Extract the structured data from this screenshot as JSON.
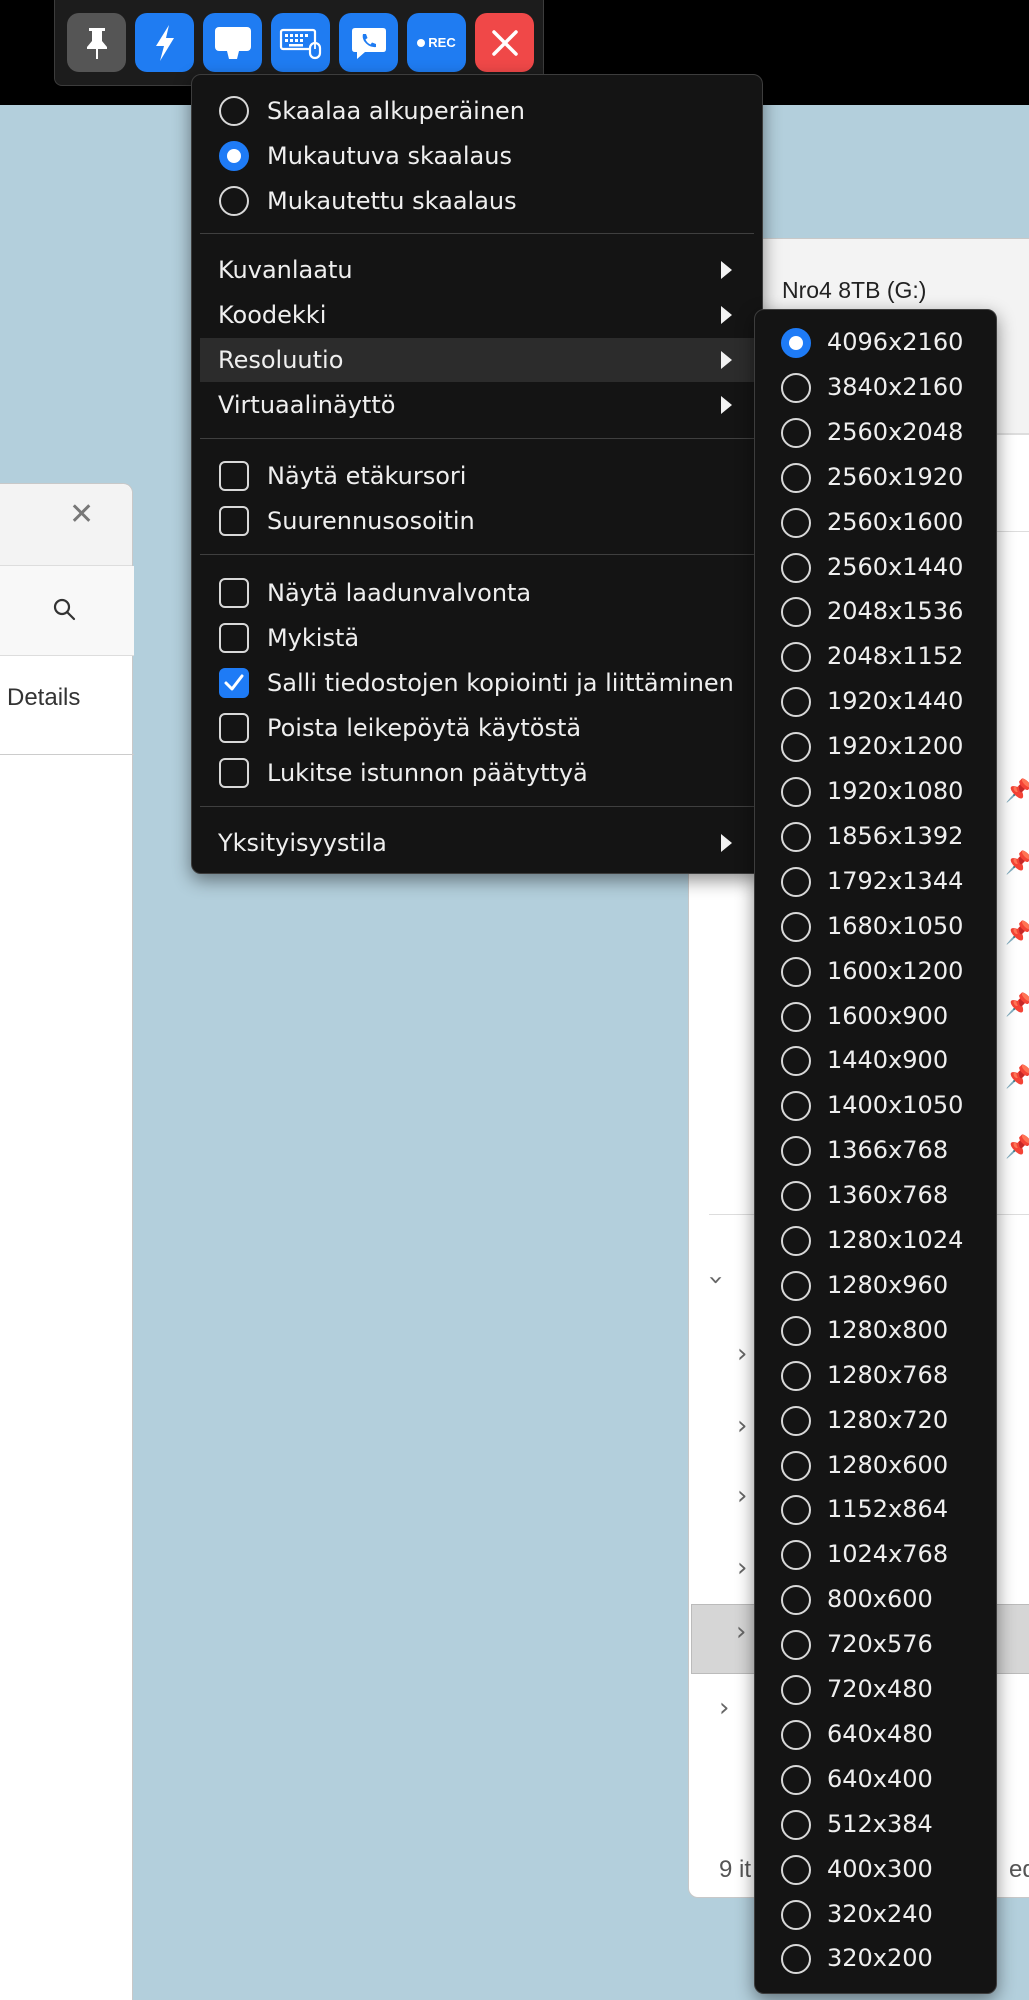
{
  "toolbar": {
    "buttons": [
      {
        "name": "pin-button",
        "icon": "pin-icon"
      },
      {
        "name": "action-button",
        "icon": "lightning-icon"
      },
      {
        "name": "display-button",
        "icon": "monitor-icon"
      },
      {
        "name": "keyboard-mouse-button",
        "icon": "keyboard-mouse-icon"
      },
      {
        "name": "chat-button",
        "icon": "chat-icon"
      },
      {
        "name": "record-button",
        "icon": "rec-icon",
        "label": "REC"
      },
      {
        "name": "close-button",
        "icon": "close-icon"
      }
    ],
    "colors": {
      "blue": "#1f7cf2",
      "dark": "#555555",
      "red": "#f04848"
    }
  },
  "menu": {
    "scaling": [
      {
        "label": "Skaalaa alkuperäinen",
        "selected": false
      },
      {
        "label": "Mukautuva skaalaus",
        "selected": true
      },
      {
        "label": "Mukautettu skaalaus",
        "selected": false
      }
    ],
    "submenus": [
      {
        "label": "Kuvanlaatu"
      },
      {
        "label": "Koodekki"
      },
      {
        "label": "Resoluutio",
        "highlighted": true
      },
      {
        "label": "Virtuaalinäyttö"
      }
    ],
    "options_a": [
      {
        "label": "Näytä etäkursori",
        "checked": false
      },
      {
        "label": "Suurennusosoitin",
        "checked": false
      }
    ],
    "options_b": [
      {
        "label": "Näytä laadunvalvonta",
        "checked": false
      },
      {
        "label": "Mykistä",
        "checked": false
      },
      {
        "label": "Salli tiedostojen kopiointi ja liittäminen",
        "checked": true
      },
      {
        "label": "Poista leikepöytä käytöstä",
        "checked": false
      },
      {
        "label": "Lukitse istunnon päätyttyä",
        "checked": false
      }
    ],
    "privacy": {
      "label": "Yksityisyystila"
    }
  },
  "resolutions": {
    "selected": "4096x2160",
    "items": [
      "4096x2160",
      "3840x2160",
      "2560x2048",
      "2560x1920",
      "2560x1600",
      "2560x1440",
      "2048x1536",
      "2048x1152",
      "1920x1440",
      "1920x1200",
      "1920x1080",
      "1856x1392",
      "1792x1344",
      "1680x1050",
      "1600x1200",
      "1600x900",
      "1440x900",
      "1400x1050",
      "1366x768",
      "1360x768",
      "1280x1024",
      "1280x960",
      "1280x800",
      "1280x768",
      "1280x720",
      "1280x600",
      "1152x864",
      "1024x768",
      "800x600",
      "720x576",
      "720x480",
      "640x480",
      "640x400",
      "512x384",
      "400x300",
      "320x240",
      "320x200"
    ]
  },
  "background": {
    "left_window": {
      "tab_label": "Details"
    },
    "right_window": {
      "drive_name": "Nro4 8TB (G:)",
      "status_left": "9 it",
      "status_right": "ed"
    }
  }
}
